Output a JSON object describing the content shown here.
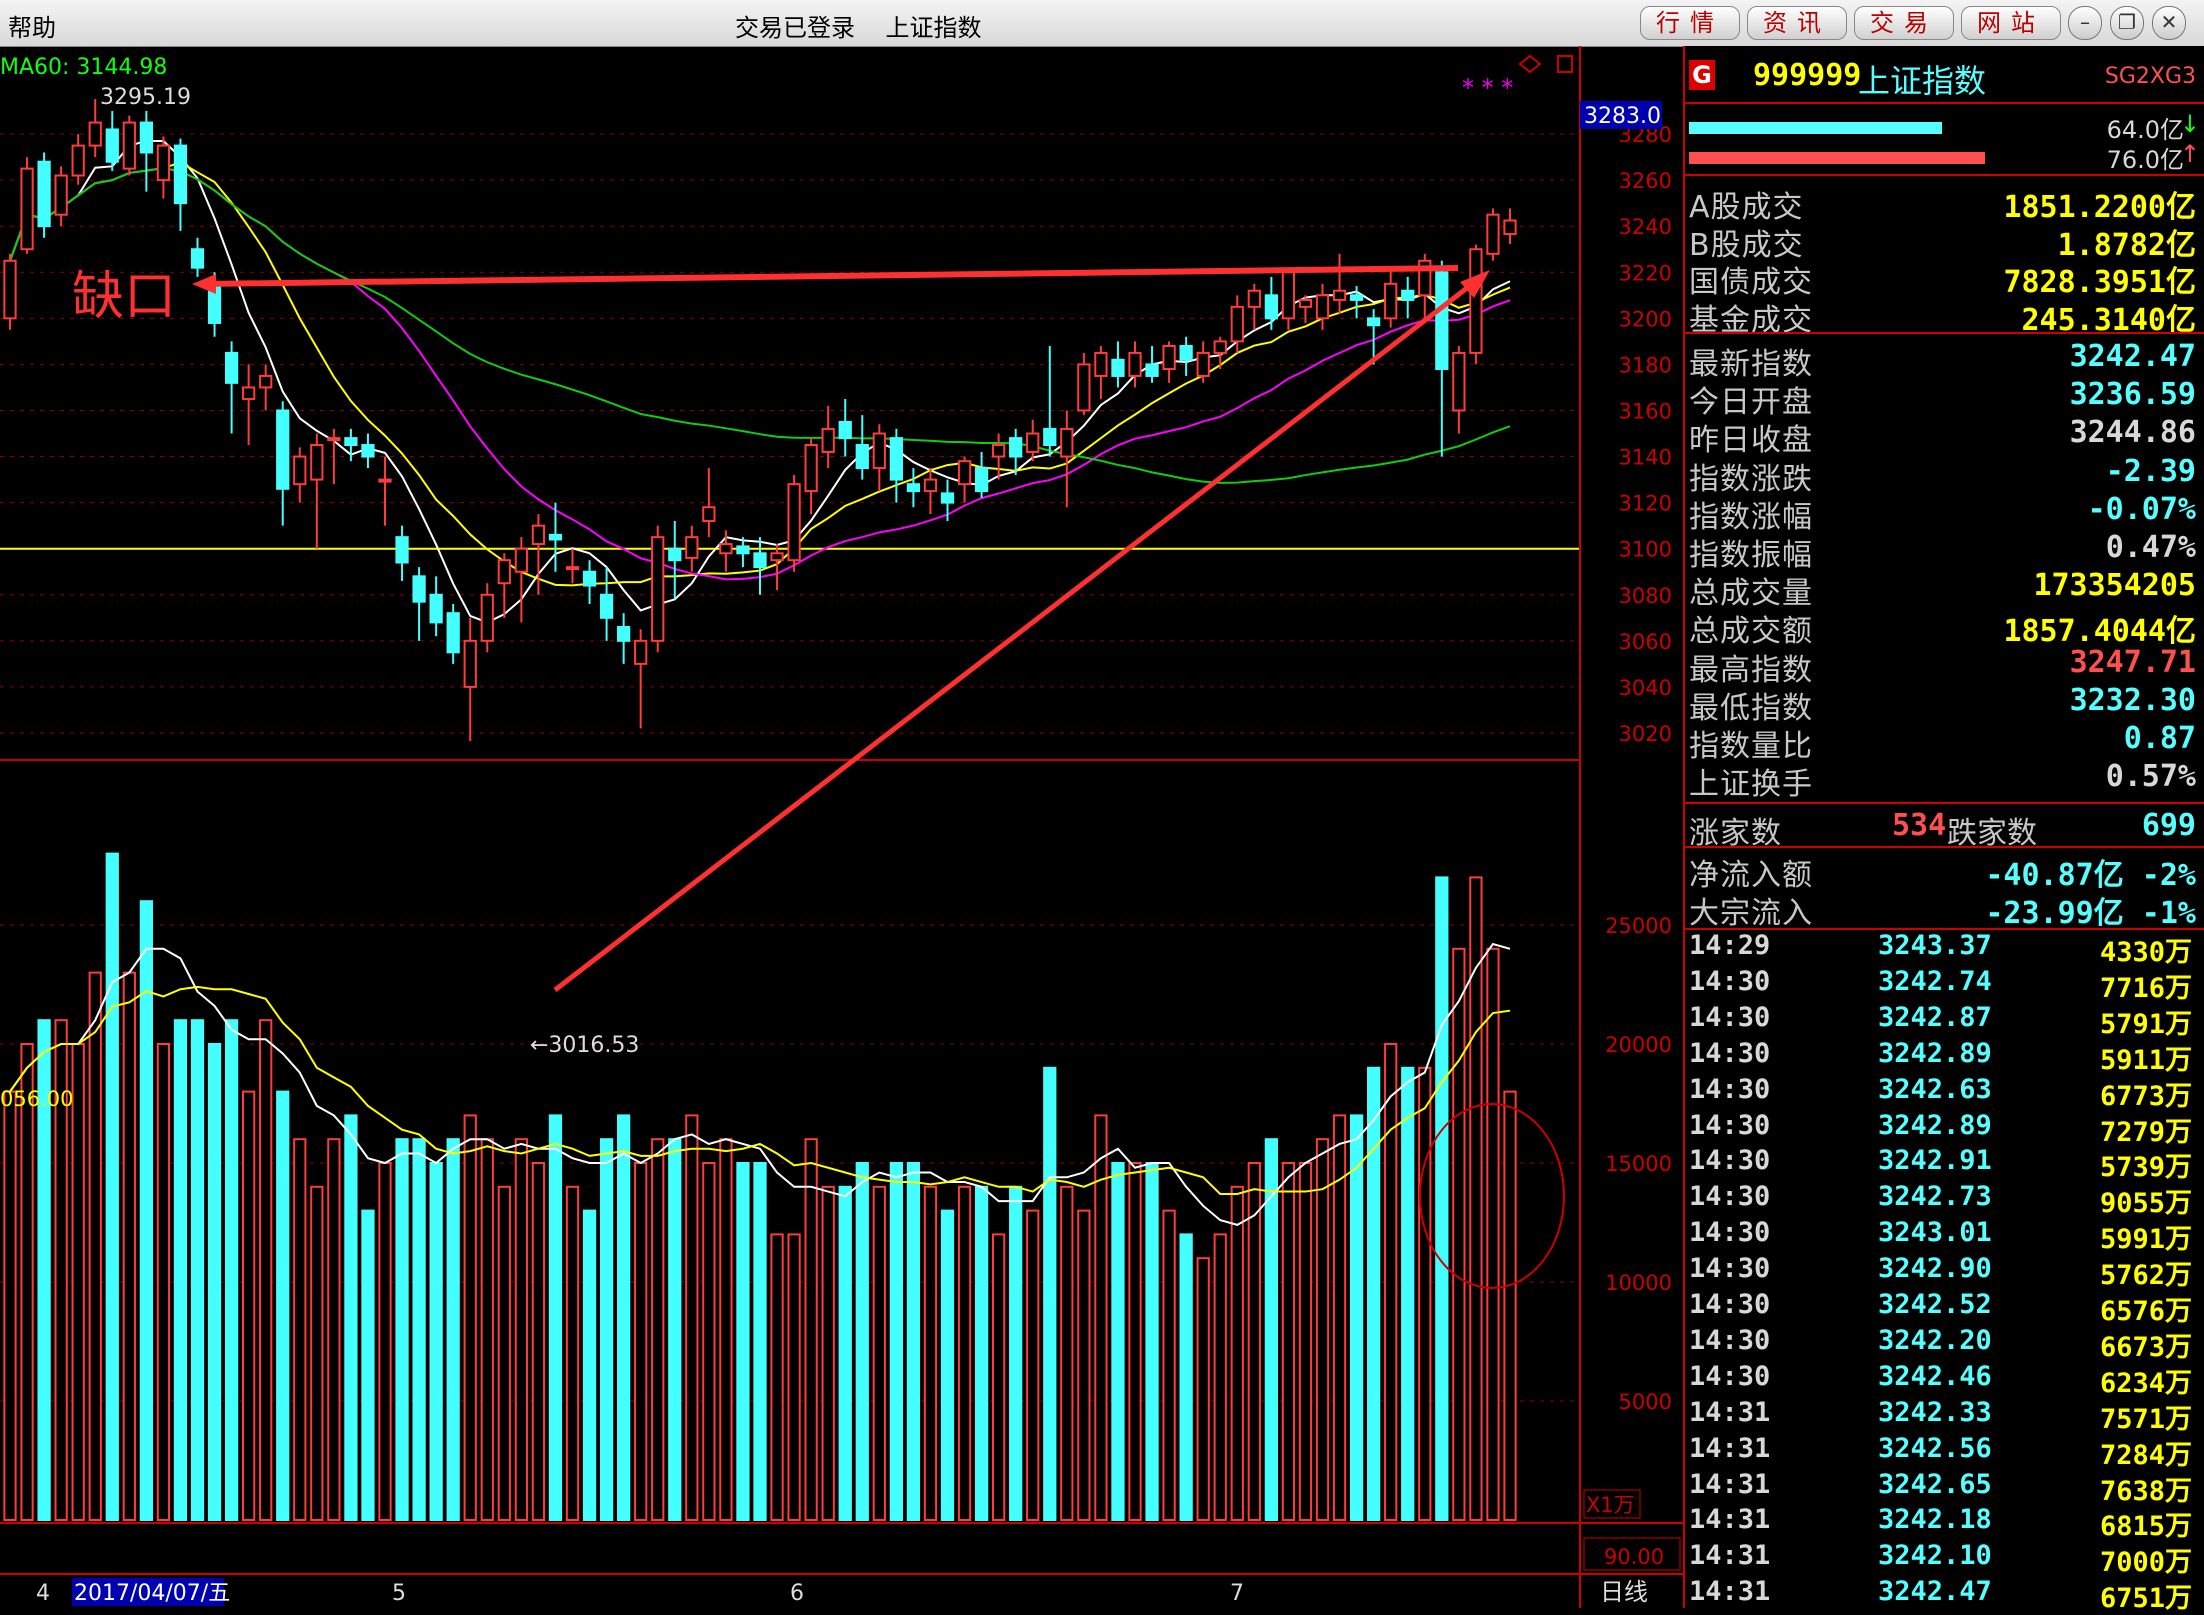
{
  "menu": {
    "help": "帮助"
  },
  "window": {
    "title": "交易已登录    上证指数"
  },
  "nav_buttons": [
    "行情",
    "资讯",
    "交易",
    "网站"
  ],
  "window_controls": [
    "minimize-icon",
    "restore-icon",
    "close-icon"
  ],
  "chart": {
    "ma60_label": "MA60: 3144.98",
    "high_marker": "3295.19",
    "low_marker": "←3016.53",
    "gap_annotation": "缺口",
    "current_price_tag": "3283.0",
    "price_ticks": [
      "3280",
      "3260",
      "3240",
      "3220",
      "3200",
      "3180",
      "3160",
      "3140",
      "3120",
      "3100",
      "3080",
      "3060",
      "3040",
      "3020"
    ],
    "volume_label": "056.00",
    "volume_ticks": [
      "25000",
      "20000",
      "15000",
      "10000",
      "5000"
    ],
    "volume_unit": "X1万",
    "sub_value": "90.00",
    "period": "日线",
    "x_labels": [
      "4",
      "2017/04/07/五",
      "5",
      "6",
      "7"
    ],
    "magenta_marks": "* * *"
  },
  "chart_data": {
    "type": "candlestick",
    "price_range": [
      3010,
      3300
    ],
    "volume_range": [
      0,
      30000
    ],
    "reference_line": 3100,
    "candles": [
      {
        "o": 3200,
        "c": 3225,
        "h": 3228,
        "l": 3195
      },
      {
        "o": 3230,
        "c": 3265,
        "h": 3270,
        "l": 3228
      },
      {
        "o": 3268,
        "c": 3240,
        "h": 3272,
        "l": 3235
      },
      {
        "o": 3245,
        "c": 3262,
        "h": 3266,
        "l": 3240
      },
      {
        "o": 3262,
        "c": 3275,
        "h": 3280,
        "l": 3258
      },
      {
        "o": 3275,
        "c": 3285,
        "h": 3295.19,
        "l": 3270
      },
      {
        "o": 3282,
        "c": 3268,
        "h": 3290,
        "l": 3264
      },
      {
        "o": 3265,
        "c": 3285,
        "h": 3288,
        "l": 3262
      },
      {
        "o": 3285,
        "c": 3272,
        "h": 3290,
        "l": 3255
      },
      {
        "o": 3260,
        "c": 3275,
        "h": 3279,
        "l": 3252
      },
      {
        "o": 3275,
        "c": 3250,
        "h": 3278,
        "l": 3238
      },
      {
        "o": 3230,
        "c": 3222,
        "h": 3235,
        "l": 3218
      },
      {
        "o": 3215,
        "c": 3198,
        "h": 3220,
        "l": 3192
      },
      {
        "o": 3185,
        "c": 3172,
        "h": 3190,
        "l": 3150
      },
      {
        "o": 3165,
        "c": 3170,
        "h": 3180,
        "l": 3145
      },
      {
        "o": 3170,
        "c": 3175,
        "h": 3180,
        "l": 3160
      },
      {
        "o": 3160,
        "c": 3126,
        "h": 3164,
        "l": 3110
      },
      {
        "o": 3128,
        "c": 3140,
        "h": 3144,
        "l": 3120
      },
      {
        "o": 3130,
        "c": 3145,
        "h": 3150,
        "l": 3100
      },
      {
        "o": 3148,
        "c": 3148,
        "h": 3152,
        "l": 3128
      },
      {
        "o": 3148,
        "c": 3145,
        "h": 3152,
        "l": 3138
      },
      {
        "o": 3145,
        "c": 3140,
        "h": 3150,
        "l": 3135
      },
      {
        "o": 3130,
        "c": 3130,
        "h": 3140,
        "l": 3110
      },
      {
        "o": 3105,
        "c": 3094,
        "h": 3110,
        "l": 3086
      },
      {
        "o": 3088,
        "c": 3077,
        "h": 3092,
        "l": 3060
      },
      {
        "o": 3080,
        "c": 3068,
        "h": 3088,
        "l": 3062
      },
      {
        "o": 3072,
        "c": 3055,
        "h": 3076,
        "l": 3050
      },
      {
        "o": 3040,
        "c": 3060,
        "h": 3070,
        "l": 3016.53
      },
      {
        "o": 3060,
        "c": 3080,
        "h": 3085,
        "l": 3055
      },
      {
        "o": 3085,
        "c": 3095,
        "h": 3098,
        "l": 3070
      },
      {
        "o": 3090,
        "c": 3100,
        "h": 3105,
        "l": 3068
      },
      {
        "o": 3102,
        "c": 3110,
        "h": 3115,
        "l": 3080
      },
      {
        "o": 3106,
        "c": 3104,
        "h": 3120,
        "l": 3090
      },
      {
        "o": 3092,
        "c": 3092,
        "h": 3100,
        "l": 3085
      },
      {
        "o": 3090,
        "c": 3084,
        "h": 3095,
        "l": 3076
      },
      {
        "o": 3080,
        "c": 3070,
        "h": 3092,
        "l": 3060
      },
      {
        "o": 3066,
        "c": 3060,
        "h": 3072,
        "l": 3050
      },
      {
        "o": 3050,
        "c": 3060,
        "h": 3065,
        "l": 3022
      },
      {
        "o": 3060,
        "c": 3105,
        "h": 3110,
        "l": 3055
      },
      {
        "o": 3100,
        "c": 3095,
        "h": 3112,
        "l": 3078
      },
      {
        "o": 3096,
        "c": 3105,
        "h": 3110,
        "l": 3090
      },
      {
        "o": 3112,
        "c": 3118,
        "h": 3135,
        "l": 3105
      },
      {
        "o": 3098,
        "c": 3102,
        "h": 3108,
        "l": 3090
      },
      {
        "o": 3101,
        "c": 3098,
        "h": 3105,
        "l": 3092
      },
      {
        "o": 3098,
        "c": 3092,
        "h": 3105,
        "l": 3080
      },
      {
        "o": 3095,
        "c": 3098,
        "h": 3102,
        "l": 3082
      },
      {
        "o": 3095,
        "c": 3128,
        "h": 3132,
        "l": 3090
      },
      {
        "o": 3125,
        "c": 3145,
        "h": 3148,
        "l": 3115
      },
      {
        "o": 3142,
        "c": 3152,
        "h": 3162,
        "l": 3135
      },
      {
        "o": 3155,
        "c": 3148,
        "h": 3165,
        "l": 3140
      },
      {
        "o": 3145,
        "c": 3135,
        "h": 3158,
        "l": 3130
      },
      {
        "o": 3135,
        "c": 3150,
        "h": 3154,
        "l": 3125
      },
      {
        "o": 3148,
        "c": 3130,
        "h": 3152,
        "l": 3120
      },
      {
        "o": 3128,
        "c": 3125,
        "h": 3135,
        "l": 3118
      },
      {
        "o": 3125,
        "c": 3130,
        "h": 3135,
        "l": 3115
      },
      {
        "o": 3124,
        "c": 3120,
        "h": 3130,
        "l": 3112
      },
      {
        "o": 3128,
        "c": 3138,
        "h": 3140,
        "l": 3120
      },
      {
        "o": 3135,
        "c": 3125,
        "h": 3142,
        "l": 3122
      },
      {
        "o": 3140,
        "c": 3145,
        "h": 3150,
        "l": 3130
      },
      {
        "o": 3148,
        "c": 3140,
        "h": 3152,
        "l": 3132
      },
      {
        "o": 3142,
        "c": 3150,
        "h": 3156,
        "l": 3138
      },
      {
        "o": 3152,
        "c": 3145,
        "h": 3188,
        "l": 3140
      },
      {
        "o": 3140,
        "c": 3152,
        "h": 3160,
        "l": 3118
      },
      {
        "o": 3160,
        "c": 3180,
        "h": 3185,
        "l": 3158
      },
      {
        "o": 3175,
        "c": 3185,
        "h": 3188,
        "l": 3165
      },
      {
        "o": 3182,
        "c": 3175,
        "h": 3190,
        "l": 3170
      },
      {
        "o": 3175,
        "c": 3185,
        "h": 3190,
        "l": 3170
      },
      {
        "o": 3180,
        "c": 3175,
        "h": 3188,
        "l": 3172
      },
      {
        "o": 3178,
        "c": 3188,
        "h": 3190,
        "l": 3172
      },
      {
        "o": 3188,
        "c": 3182,
        "h": 3192,
        "l": 3175
      },
      {
        "o": 3175,
        "c": 3185,
        "h": 3190,
        "l": 3172
      },
      {
        "o": 3185,
        "c": 3190,
        "h": 3192,
        "l": 3178
      },
      {
        "o": 3190,
        "c": 3205,
        "h": 3210,
        "l": 3185
      },
      {
        "o": 3205,
        "c": 3212,
        "h": 3215,
        "l": 3195
      },
      {
        "o": 3210,
        "c": 3200,
        "h": 3218,
        "l": 3195
      },
      {
        "o": 3200,
        "c": 3220,
        "h": 3222,
        "l": 3195
      },
      {
        "o": 3205,
        "c": 3208,
        "h": 3210,
        "l": 3198
      },
      {
        "o": 3200,
        "c": 3210,
        "h": 3215,
        "l": 3195
      },
      {
        "o": 3208,
        "c": 3212,
        "h": 3228,
        "l": 3202
      },
      {
        "o": 3210,
        "c": 3208,
        "h": 3214,
        "l": 3200
      },
      {
        "o": 3200,
        "c": 3197,
        "h": 3204,
        "l": 3180
      },
      {
        "o": 3200,
        "c": 3215,
        "h": 3222,
        "l": 3196
      },
      {
        "o": 3212,
        "c": 3208,
        "h": 3218,
        "l": 3200
      },
      {
        "o": 3210,
        "c": 3225,
        "h": 3228,
        "l": 3200
      },
      {
        "o": 3220,
        "c": 3178,
        "h": 3225,
        "l": 3140
      },
      {
        "o": 3160,
        "c": 3185,
        "h": 3188,
        "l": 3150
      },
      {
        "o": 3185,
        "c": 3230,
        "h": 3232,
        "l": 3180
      },
      {
        "o": 3228,
        "c": 3245,
        "h": 3247.71,
        "l": 3225
      },
      {
        "o": 3236.59,
        "c": 3242.47,
        "h": 3247.71,
        "l": 3232.3
      }
    ],
    "volumes": [
      18000,
      20000,
      21000,
      21000,
      20000,
      23000,
      28000,
      23000,
      26000,
      20000,
      21000,
      21000,
      20000,
      21000,
      18000,
      21000,
      18000,
      16000,
      14000,
      16000,
      17000,
      13000,
      15000,
      16000,
      16000,
      15000,
      16000,
      17000,
      16000,
      14000,
      16000,
      15000,
      17000,
      14000,
      13000,
      16000,
      17000,
      15000,
      16000,
      16000,
      17000,
      15000,
      16000,
      15000,
      15000,
      12000,
      12000,
      16000,
      14000,
      14000,
      15000,
      14000,
      15000,
      15000,
      14000,
      13000,
      14000,
      14000,
      12000,
      14000,
      13000,
      19000,
      14000,
      13000,
      17000,
      15000,
      15000,
      15000,
      13000,
      12000,
      11000,
      12000,
      14000,
      15000,
      16000,
      15000,
      15000,
      16000,
      17000,
      17000,
      19000,
      20000,
      19000,
      19000,
      27000,
      24000,
      27000,
      24000,
      18000
    ]
  },
  "quote": {
    "badge": "G",
    "code": "999999",
    "name": "上证指数",
    "tags": "SG2XG3",
    "buy_flow": "64.0亿",
    "sell_flow": "76.0亿",
    "turnover": [
      {
        "label": "A股成交",
        "value": "1851.2200亿"
      },
      {
        "label": "B股成交",
        "value": "1.8782亿"
      },
      {
        "label": "国债成交",
        "value": "7828.3951亿"
      },
      {
        "label": "基金成交",
        "value": "245.3140亿"
      }
    ],
    "stats": [
      {
        "label": "最新指数",
        "value": "3242.47",
        "color": "#5ff"
      },
      {
        "label": "今日开盘",
        "value": "3236.59",
        "color": "#5ff"
      },
      {
        "label": "昨日收盘",
        "value": "3244.86",
        "color": "#d8d8d8"
      },
      {
        "label": "指数涨跌",
        "value": "-2.39",
        "color": "#5ff"
      },
      {
        "label": "指数涨幅",
        "value": "-0.07%",
        "color": "#5ff"
      },
      {
        "label": "指数振幅",
        "value": "0.47%",
        "color": "#d8d8d8"
      },
      {
        "label": "总成交量",
        "value": "173354205",
        "color": "#ff0"
      },
      {
        "label": "总成交额",
        "value": "1857.4044亿",
        "color": "#ff0"
      },
      {
        "label": "最高指数",
        "value": "3247.71",
        "color": "#ff5050"
      },
      {
        "label": "最低指数",
        "value": "3232.30",
        "color": "#5ff"
      },
      {
        "label": "指数量比",
        "value": "0.87",
        "color": "#5ff"
      },
      {
        "label": "上证换手",
        "value": "0.57%",
        "color": "#d8d8d8"
      }
    ],
    "rise_label": "涨家数",
    "rise_count": "534",
    "fall_label": "跌家数",
    "fall_count": "699",
    "net_inflow_label": "净流入额",
    "net_inflow": "-40.87亿 -2%",
    "block_inflow_label": "大宗流入",
    "block_inflow": "-23.99亿 -1%"
  },
  "ticks": [
    {
      "time": "14:29",
      "price": "3243.37",
      "vol": "4330万"
    },
    {
      "time": "14:30",
      "price": "3242.74",
      "vol": "7716万"
    },
    {
      "time": "14:30",
      "price": "3242.87",
      "vol": "5791万"
    },
    {
      "time": "14:30",
      "price": "3242.89",
      "vol": "5911万"
    },
    {
      "time": "14:30",
      "price": "3242.63",
      "vol": "6773万"
    },
    {
      "time": "14:30",
      "price": "3242.89",
      "vol": "7279万"
    },
    {
      "time": "14:30",
      "price": "3242.91",
      "vol": "5739万"
    },
    {
      "time": "14:30",
      "price": "3242.73",
      "vol": "9055万"
    },
    {
      "time": "14:30",
      "price": "3243.01",
      "vol": "5991万"
    },
    {
      "time": "14:30",
      "price": "3242.90",
      "vol": "5762万"
    },
    {
      "time": "14:30",
      "price": "3242.52",
      "vol": "6576万"
    },
    {
      "time": "14:30",
      "price": "3242.20",
      "vol": "6673万"
    },
    {
      "time": "14:30",
      "price": "3242.46",
      "vol": "6234万"
    },
    {
      "time": "14:31",
      "price": "3242.33",
      "vol": "7571万"
    },
    {
      "time": "14:31",
      "price": "3242.56",
      "vol": "7284万"
    },
    {
      "time": "14:31",
      "price": "3242.65",
      "vol": "7638万"
    },
    {
      "time": "14:31",
      "price": "3242.18",
      "vol": "6815万"
    },
    {
      "time": "14:31",
      "price": "3242.10",
      "vol": "7000万"
    },
    {
      "time": "14:31",
      "price": "3242.47",
      "vol": "6751万"
    }
  ]
}
